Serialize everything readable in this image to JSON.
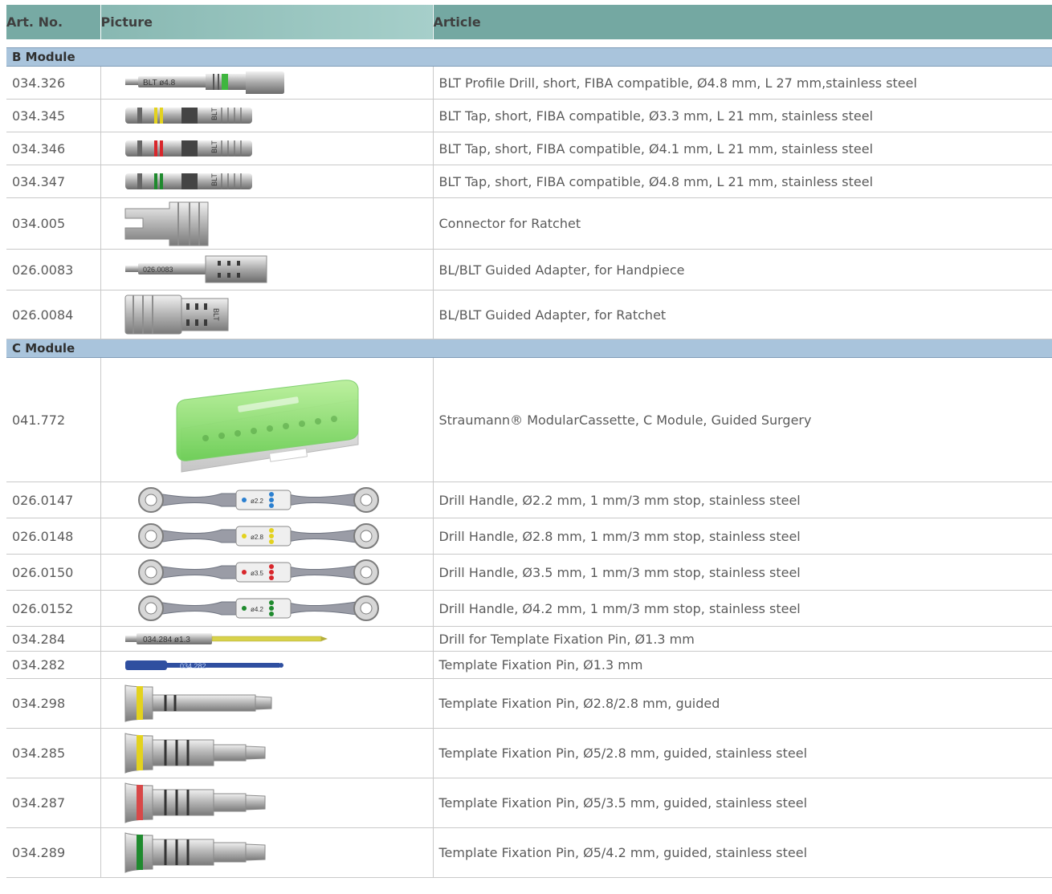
{
  "header": {
    "art_no": "Art. No.",
    "picture": "Picture",
    "article": "Article"
  },
  "modules": [
    {
      "name": "B Module",
      "rows": [
        {
          "art": "034.326",
          "desc": "BLT Profile Drill, short, FIBA compatible, Ø4.8 mm, L 27 mm,stainless steel",
          "label": "BLT ø4.8",
          "icon": "profile-drill-image",
          "color": "#3fb63f"
        },
        {
          "art": "034.345",
          "desc": "BLT Tap, short, FIBA compatible, Ø3.3 mm, L 21 mm, stainless steel",
          "label": "BLT",
          "icon": "tap-image",
          "color": "#e3d21e"
        },
        {
          "art": "034.346",
          "desc": "BLT Tap, short, FIBA compatible, Ø4.1 mm, L 21 mm, stainless steel",
          "label": "BLT",
          "icon": "tap-image",
          "color": "#d8262b"
        },
        {
          "art": "034.347",
          "desc": "BLT Tap, short, FIBA compatible, Ø4.8 mm, L 21 mm, stainless steel",
          "label": "BLT",
          "icon": "tap-image",
          "color": "#1f8a2e"
        },
        {
          "art": "034.005",
          "desc": "Connector for Ratchet",
          "icon": "connector-image"
        },
        {
          "art": "026.0083",
          "desc": "BL/BLT Guided Adapter, for Handpiece",
          "label": "026.0083",
          "icon": "handpiece-adapter-image"
        },
        {
          "art": "026.0084",
          "desc": "BL/BLT Guided Adapter, for Ratchet",
          "label": "BLT",
          "icon": "ratchet-adapter-image"
        }
      ]
    },
    {
      "name": "C Module",
      "rows": [
        {
          "art": "041.772",
          "desc": "Straumann® ModularCassette, C Module, Guided Surgery",
          "icon": "cassette-image",
          "color": "#8fe07a"
        },
        {
          "art": "026.0147",
          "desc": "Drill Handle, Ø2.2 mm, 1 mm/3 mm stop, stainless steel",
          "label": "ø2.2",
          "icon": "drill-handle-image",
          "color": "#2a7fd0"
        },
        {
          "art": "026.0148",
          "desc": "Drill Handle, Ø2.8 mm, 1 mm/3 mm stop, stainless steel",
          "label": "ø2.8",
          "icon": "drill-handle-image",
          "color": "#e3d21e"
        },
        {
          "art": "026.0150",
          "desc": "Drill Handle, Ø3.5 mm, 1 mm/3 mm stop, stainless steel",
          "label": "ø3.5",
          "icon": "drill-handle-image",
          "color": "#d8262b"
        },
        {
          "art": "026.0152",
          "desc": "Drill Handle, Ø4.2 mm, 1 mm/3 mm stop, stainless steel",
          "label": "ø4.2",
          "icon": "drill-handle-image",
          "color": "#1f8a2e"
        },
        {
          "art": "034.284",
          "desc": "Drill for Template Fixation Pin, Ø1.3 mm",
          "label": "034.284  ø1.3",
          "icon": "fixation-drill-image",
          "color": "#d8d24a"
        },
        {
          "art": "034.282",
          "desc": "Template Fixation Pin, Ø1.3 mm",
          "label": "034.282",
          "icon": "fixation-pin-image",
          "color": "#2f4fa0"
        },
        {
          "art": "034.298",
          "desc": "Template Fixation Pin, Ø2.8/2.8 mm, guided",
          "icon": "guided-pin-image",
          "color": "#e3d21e"
        },
        {
          "art": "034.285",
          "desc": "Template Fixation Pin, Ø5/2.8 mm, guided, stainless steel",
          "icon": "guided-pin-image",
          "color": "#e3d21e"
        },
        {
          "art": "034.287",
          "desc": "Template Fixation Pin, Ø5/3.5 mm, guided, stainless steel",
          "icon": "guided-pin-image",
          "color": "#d84848"
        },
        {
          "art": "034.289",
          "desc": "Template Fixation Pin, Ø5/4.2 mm, guided, stainless steel",
          "icon": "guided-pin-image",
          "color": "#1f8a2e"
        }
      ]
    }
  ]
}
